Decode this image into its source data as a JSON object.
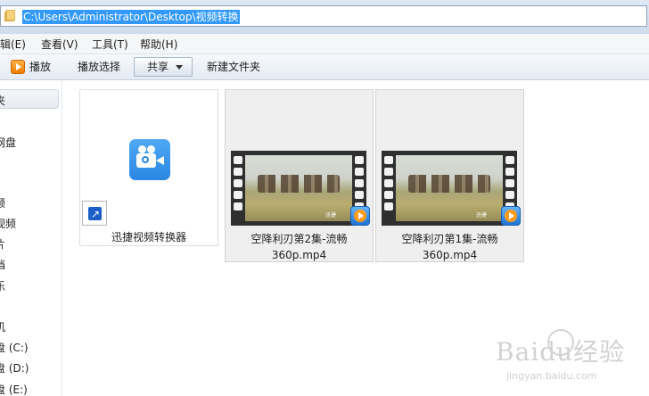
{
  "address_bar": {
    "path": "C:\\Users\\Administrator\\Desktop\\视频转换"
  },
  "menu": {
    "items": [
      {
        "label": "编辑(E)"
      },
      {
        "label": "查看(V)"
      },
      {
        "label": "工具(T)"
      },
      {
        "label": "帮助(H)"
      }
    ]
  },
  "toolbar": {
    "play_label": "播放",
    "play_selection_label": "播放选择",
    "share_label": "共享",
    "new_folder_label": "新建文件夹"
  },
  "nav_pane": {
    "items": [
      {
        "label": "夹"
      },
      {
        "label": "网盘"
      },
      {
        "label": "频"
      },
      {
        "label": "视频"
      },
      {
        "label": "片"
      },
      {
        "label": "档"
      },
      {
        "label": "乐"
      },
      {
        "label": "机"
      },
      {
        "label": "盘 (C:)"
      },
      {
        "label": "盘 (D:)"
      },
      {
        "label": "盘 (E:)"
      }
    ]
  },
  "files": [
    {
      "name": "迅捷视频转换器",
      "icon": "video-converter-app-icon",
      "type": "shortcut"
    },
    {
      "name_line1": "空降利刃第2集-流畅",
      "name_line2": "360p.mp4",
      "icon": "video-thumbnail",
      "watermark": "迅捷"
    },
    {
      "name_line1": "空降利刃第1集-流畅",
      "name_line2": "360p.mp4",
      "icon": "video-thumbnail",
      "watermark": "迅捷"
    }
  ],
  "watermark": {
    "brand": "Baidu经验",
    "site": "jingyan.baidu.com"
  },
  "colors": {
    "selection": "#3399ff",
    "app_icon_blue": "#2b86e3"
  }
}
